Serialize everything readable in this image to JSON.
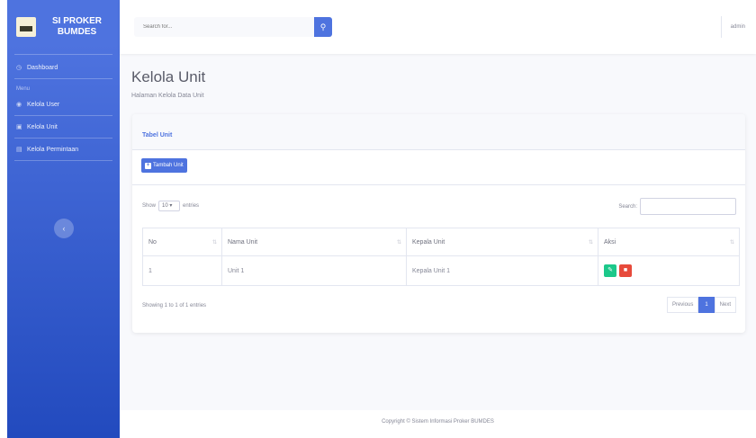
{
  "sidebar": {
    "brand": "SI PROKER BUMDES",
    "dashboard": "Dashboard",
    "heading": "Menu",
    "items": [
      {
        "label": "Kelola User"
      },
      {
        "label": "Kelola Unit"
      },
      {
        "label": "Kelola Permintaan"
      }
    ],
    "toggle_icon": "chevron-left-icon"
  },
  "topbar": {
    "search_placeholder": "Search for...",
    "user": "admin"
  },
  "page": {
    "title": "Kelola Unit",
    "subtitle": "Halaman Kelola Data Unit"
  },
  "card": {
    "header": "Tabel Unit",
    "add_button": "Tambah Unit",
    "show_label": "Show",
    "show_value": "10",
    "entries_label": "entries",
    "search_label": "Search:"
  },
  "table": {
    "columns": [
      "No",
      "Nama Unit",
      "Kepala Unit",
      "Aksi"
    ],
    "rows": [
      {
        "no": "1",
        "nama": "Unit 1",
        "kepala": "Kepala Unit 1"
      }
    ]
  },
  "info": "Showing 1 to 1 of 1 entries",
  "pagination": {
    "previous": "Previous",
    "page": "1",
    "next": "Next"
  },
  "footer": "Copyright © Sistem Informasi Proker BUMDES"
}
